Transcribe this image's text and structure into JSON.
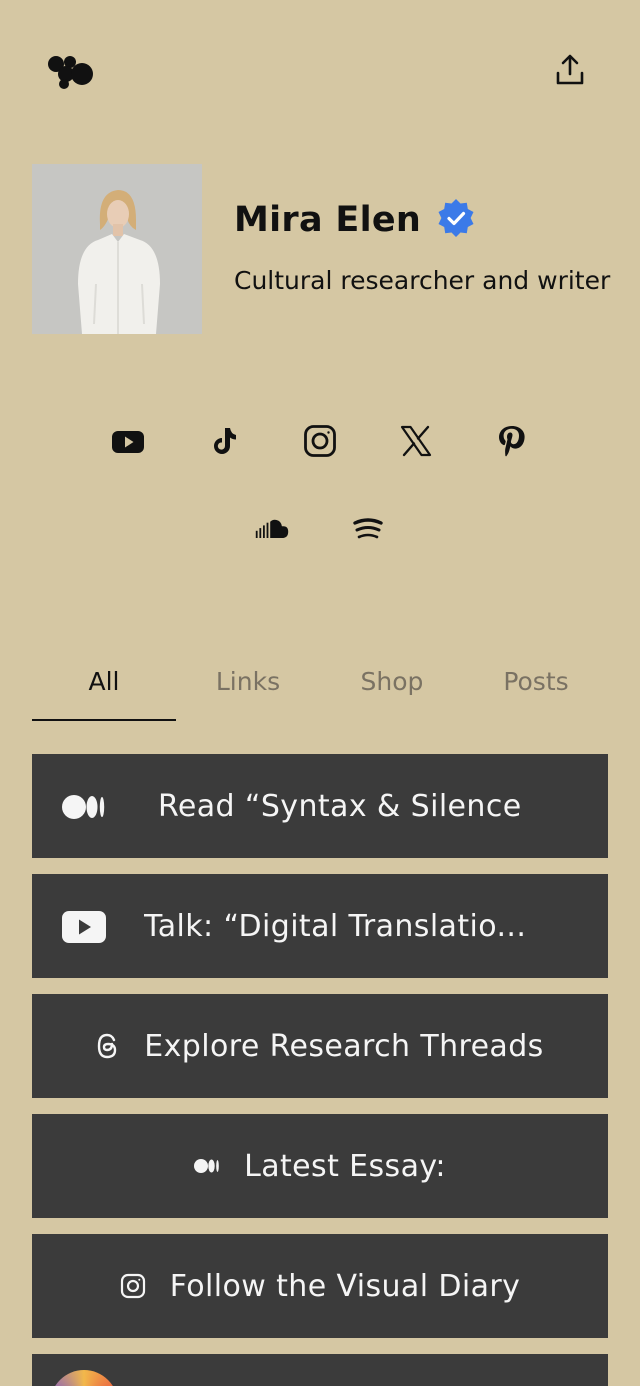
{
  "profile": {
    "name": "Mira Elen",
    "bio": "Cultural researcher and writer"
  },
  "social_links": [
    {
      "icon": "youtube-icon"
    },
    {
      "icon": "tiktok-icon"
    },
    {
      "icon": "instagram-icon"
    },
    {
      "icon": "x-icon"
    },
    {
      "icon": "pinterest-icon"
    },
    {
      "icon": "soundcloud-icon"
    },
    {
      "icon": "spotify-icon"
    }
  ],
  "tabs": [
    {
      "label": "All",
      "active": true
    },
    {
      "label": "Links",
      "active": false
    },
    {
      "label": "Shop",
      "active": false
    },
    {
      "label": "Posts",
      "active": false
    }
  ],
  "links": [
    {
      "label": "Read “Syntax & Silence",
      "icon": "medium-icon"
    },
    {
      "label": "Talk: “Digital Translatio...",
      "icon": "youtube-icon"
    },
    {
      "label": "Explore Research Threads",
      "icon": "threads-icon"
    },
    {
      "label": "Latest Essay:",
      "icon": "medium-icon"
    },
    {
      "label": "Follow the Visual Diary",
      "icon": "instagram-icon"
    }
  ],
  "colors": {
    "background": "#d5c7a3",
    "button": "#3b3b3b",
    "button_text": "#f5f5f5",
    "verified": "#3b7ae8",
    "tab_inactive": "#7a7263"
  }
}
